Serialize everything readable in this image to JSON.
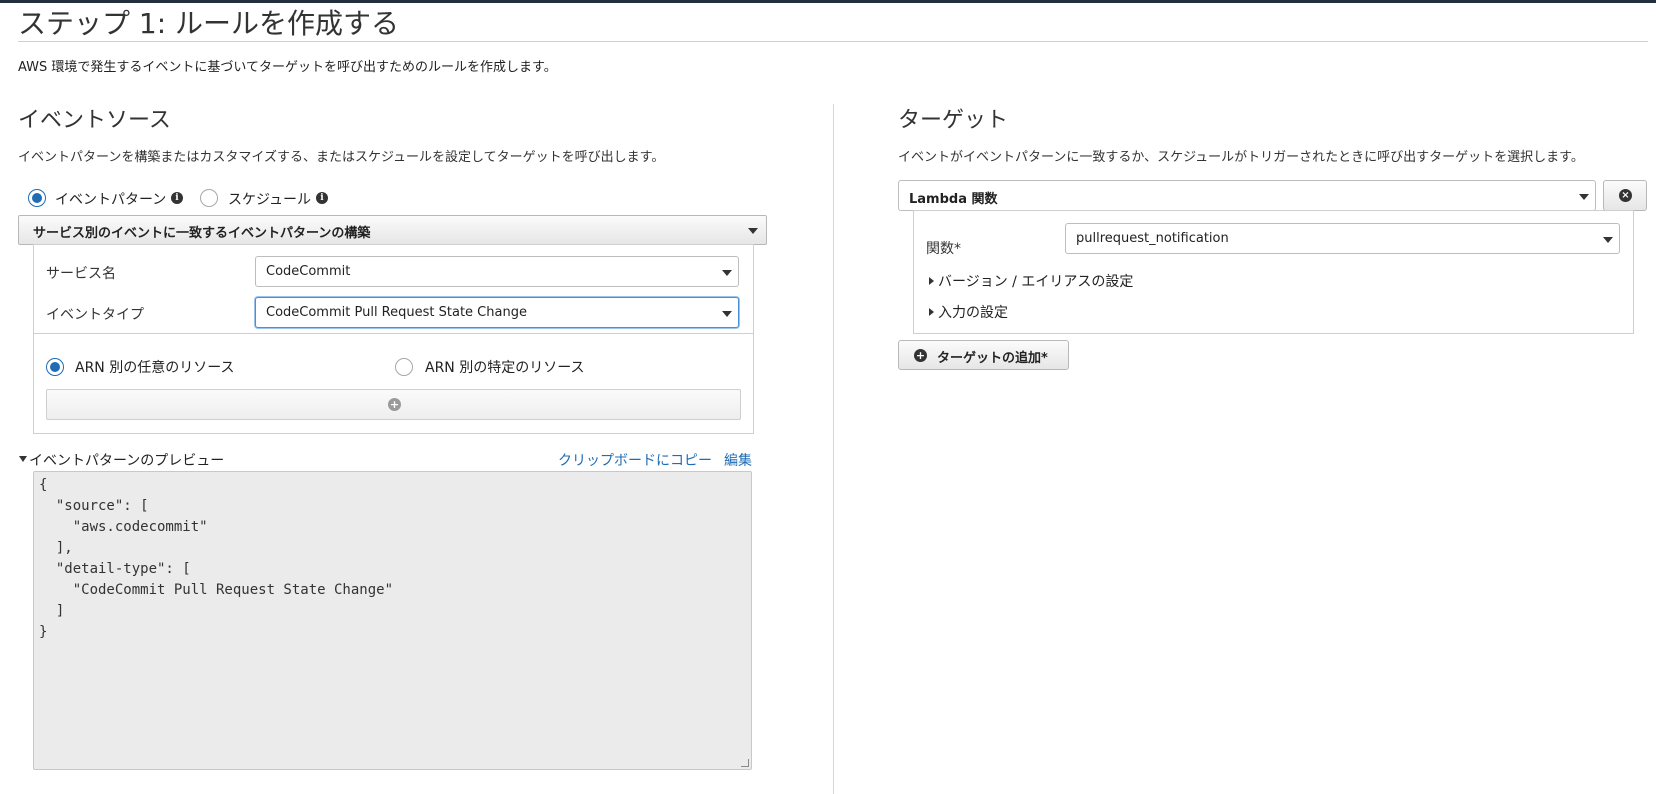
{
  "page": {
    "title": "ステップ 1: ルールを作成する",
    "description": "AWS 環境で発生するイベントに基づいてターゲットを呼び出すためのルールを作成します。"
  },
  "event_source": {
    "title": "イベントソース",
    "description": "イベントパターンを構築またはカスタマイズする、またはスケジュールを設定してターゲットを呼び出します。",
    "mode_options": [
      {
        "label": "イベントパターン",
        "selected": true
      },
      {
        "label": "スケジュール",
        "selected": false
      }
    ],
    "builder_label": "サービス別のイベントに一致するイベントパターンの構築",
    "service_name_label": "サービス名",
    "service_name_value": "CodeCommit",
    "event_type_label": "イベントタイプ",
    "event_type_value": "CodeCommit Pull Request State Change",
    "resource_options": [
      {
        "label": "ARN 別の任意のリソース",
        "selected": true
      },
      {
        "label": "ARN 別の特定のリソース",
        "selected": false
      }
    ],
    "preview": {
      "label": "イベントパターンのプレビュー",
      "copy_link": "クリップボードにコピー",
      "edit_link": "編集",
      "code": "{\n  \"source\": [\n    \"aws.codecommit\"\n  ],\n  \"detail-type\": [\n    \"CodeCommit Pull Request State Change\"\n  ]\n}"
    }
  },
  "targets": {
    "title": "ターゲット",
    "description": "イベントがイベントパターンに一致するか、スケジュールがトリガーされたときに呼び出すターゲットを選択します。",
    "target_type": "Lambda 関数",
    "function_label": "関数*",
    "function_value": "pullrequest_notification",
    "version_alias_label": "バージョン / エイリアスの設定",
    "input_label": "入力の設定",
    "add_target_label": "ターゲットの追加*"
  },
  "colors": {
    "accent": "#1f6cb4",
    "topbar": "#232f3e"
  }
}
